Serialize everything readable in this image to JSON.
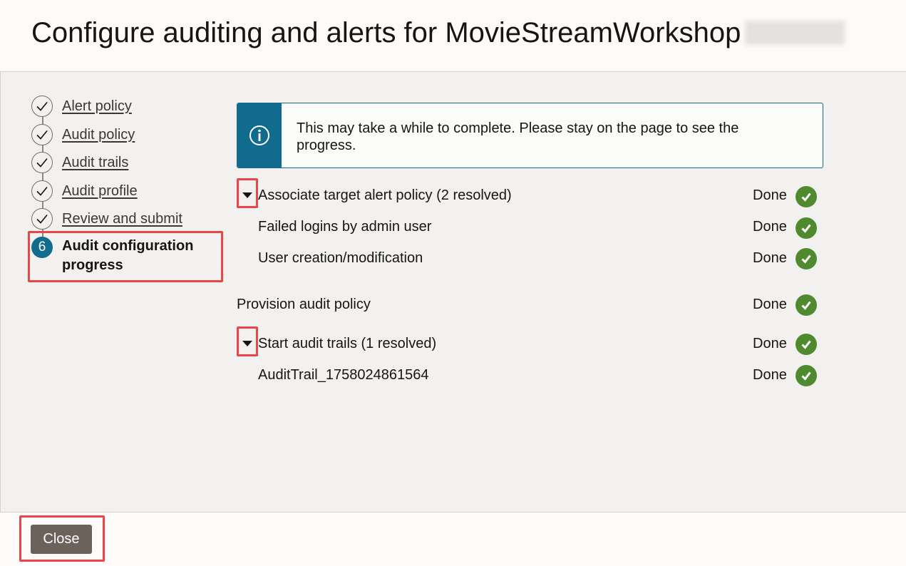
{
  "header": {
    "title": "Configure auditing and alerts for MovieStreamWorkshop"
  },
  "steps": [
    {
      "label": "Alert policy",
      "state": "completed"
    },
    {
      "label": "Audit policy",
      "state": "completed"
    },
    {
      "label": "Audit trails",
      "state": "completed"
    },
    {
      "label": "Audit profile",
      "state": "completed"
    },
    {
      "label": "Review and submit",
      "state": "completed"
    },
    {
      "number": "6",
      "label": "Audit configuration progress",
      "state": "current"
    }
  ],
  "info": {
    "icon": "info-icon",
    "message": "This may take a while to complete. Please stay on the page to see the progress."
  },
  "progress": {
    "alert_group": {
      "label": "Associate target alert policy (2 resolved)",
      "status": "Done",
      "children": [
        {
          "label": "Failed logins by admin user",
          "status": "Done"
        },
        {
          "label": "User creation/modification",
          "status": "Done"
        }
      ]
    },
    "provision": {
      "label": "Provision audit policy",
      "status": "Done"
    },
    "trails_group": {
      "label": "Start audit trails (1 resolved)",
      "status": "Done",
      "children": [
        {
          "label": "AuditTrail_1758024861564",
          "status": "Done"
        }
      ]
    }
  },
  "footer": {
    "close_label": "Close"
  },
  "colors": {
    "accent": "#136b8d",
    "success": "#508a2e",
    "highlight": "#e8474a",
    "button": "#6b625c"
  }
}
